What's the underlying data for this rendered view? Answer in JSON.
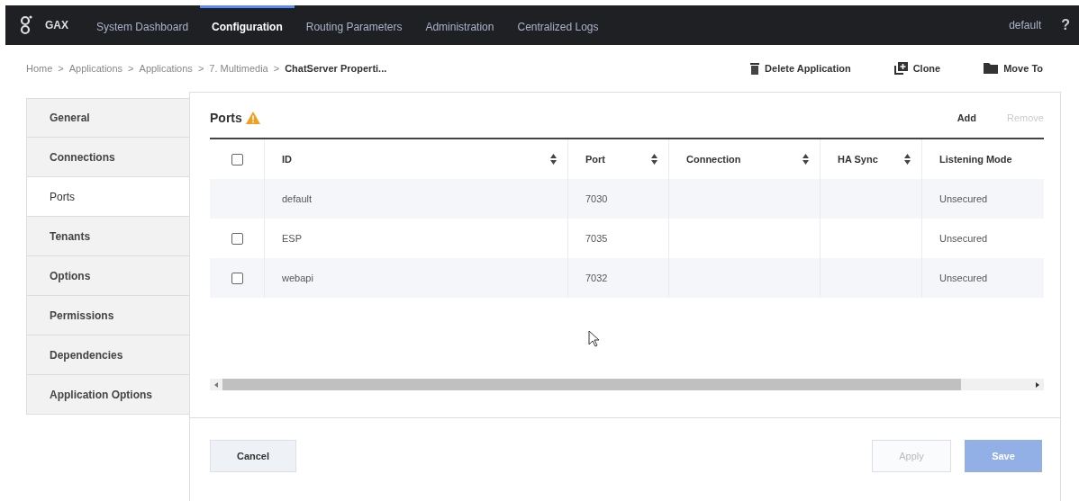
{
  "nav": {
    "brand": "GAX",
    "items": [
      {
        "label": "System Dashboard",
        "selected": false
      },
      {
        "label": "Configuration",
        "selected": true
      },
      {
        "label": "Routing Parameters",
        "selected": false
      },
      {
        "label": "Administration",
        "selected": false
      },
      {
        "label": "Centralized Logs",
        "selected": false
      }
    ],
    "user": "default",
    "help": "?"
  },
  "breadcrumb": {
    "items": [
      "Home",
      "Applications",
      "Applications",
      "7. Multimedia"
    ],
    "separator": ">",
    "current": "ChatServer Properti..."
  },
  "actions": [
    {
      "kind": "delete",
      "label": "Delete Application"
    },
    {
      "kind": "clone",
      "label": "Clone"
    },
    {
      "kind": "move",
      "label": "Move To"
    }
  ],
  "sidebar": {
    "items": [
      {
        "label": "General",
        "selected": false
      },
      {
        "label": "Connections",
        "selected": false
      },
      {
        "label": "Ports",
        "selected": true
      },
      {
        "label": "Tenants",
        "selected": false
      },
      {
        "label": "Options",
        "selected": false
      },
      {
        "label": "Permissions",
        "selected": false
      },
      {
        "label": "Dependencies",
        "selected": false
      },
      {
        "label": "Application Options",
        "selected": false
      }
    ]
  },
  "section": {
    "title": "Ports",
    "warning": true,
    "add": {
      "label": "Add",
      "disabled": false
    },
    "remove": {
      "label": "Remove",
      "disabled": true
    }
  },
  "table": {
    "select_all_checked": false,
    "columns": [
      {
        "label": "ID",
        "sortable": true
      },
      {
        "label": "Port",
        "sortable": true
      },
      {
        "label": "Connection",
        "sortable": true
      },
      {
        "label": "HA Sync",
        "sortable": true
      },
      {
        "label": "Listening Mode",
        "sortable": false
      }
    ],
    "rows": [
      {
        "cells": [
          "default",
          "7030",
          "",
          "",
          "Unsecured"
        ]
      },
      {
        "checked": false,
        "cells": [
          "ESP",
          "7035",
          "",
          "",
          "Unsecured"
        ]
      },
      {
        "checked": false,
        "cells": [
          "webapi",
          "7032",
          "",
          "",
          "Unsecured"
        ]
      }
    ]
  },
  "footer": {
    "cancel": {
      "label": "Cancel"
    },
    "apply": {
      "label": "Apply",
      "disabled": true
    },
    "save": {
      "label": "Save",
      "disabled": true
    }
  }
}
